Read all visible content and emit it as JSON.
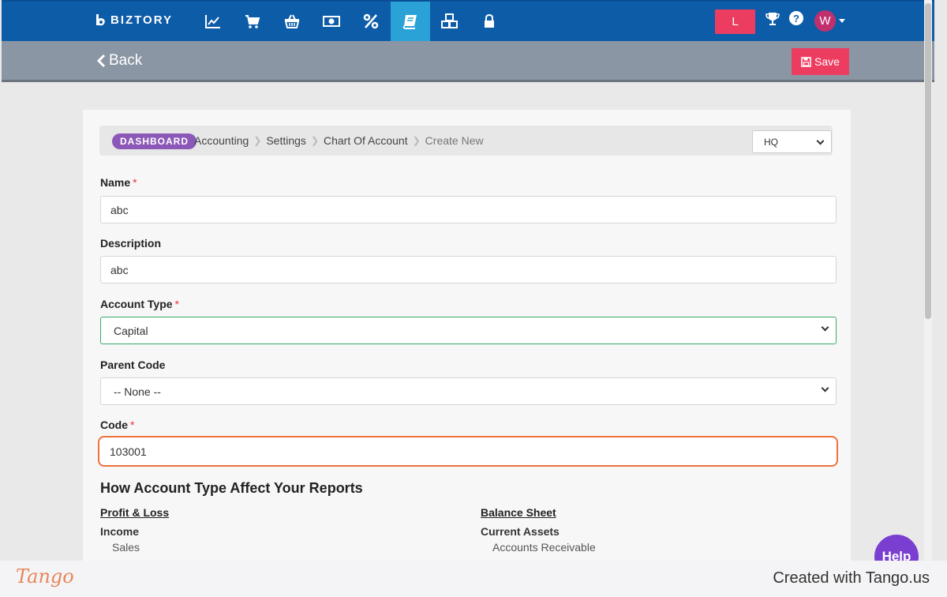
{
  "app": {
    "brand": "BIZTORY"
  },
  "topnav": {
    "icons": [
      "chart-line-icon",
      "cart-icon",
      "basket-icon",
      "money-icon",
      "percent-icon",
      "book-icon",
      "cubes-icon",
      "lock-icon"
    ],
    "active": "book-icon",
    "user_initial_box": "L",
    "avatar_initial": "W"
  },
  "subbar": {
    "back_label": "Back",
    "save_label": "Save"
  },
  "breadcrumb": {
    "dashboard": "DASHBOARD",
    "items": [
      "Accounting",
      "Settings",
      "Chart Of Account",
      "Create New"
    ],
    "branch_select": "HQ"
  },
  "form": {
    "name": {
      "label": "Name",
      "required": "*",
      "value": "abc"
    },
    "description": {
      "label": "Description",
      "value": "abc"
    },
    "account_type": {
      "label": "Account Type",
      "required": "*",
      "value": "Capital"
    },
    "parent_code": {
      "label": "Parent Code",
      "value": "-- None --"
    },
    "code": {
      "label": "Code",
      "required": "*",
      "value": "103001"
    }
  },
  "reports": {
    "heading": "How Account Type Affect Your Reports",
    "profit_loss": {
      "title": "Profit & Loss",
      "group": "Income",
      "items": [
        "Sales"
      ]
    },
    "balance_sheet": {
      "title": "Balance Sheet",
      "group": "Current Assets",
      "items": [
        "Accounts Receivable"
      ]
    }
  },
  "help_label": "Help",
  "footer": {
    "logo": "Tango",
    "created": "Created with Tango.us"
  },
  "colors": {
    "nav": "#0d5ca8",
    "active_tab": "#2aa2d8",
    "accent": "#ec3d61",
    "dashboard_badge": "#8b58b8",
    "focus": "#f0713e"
  }
}
